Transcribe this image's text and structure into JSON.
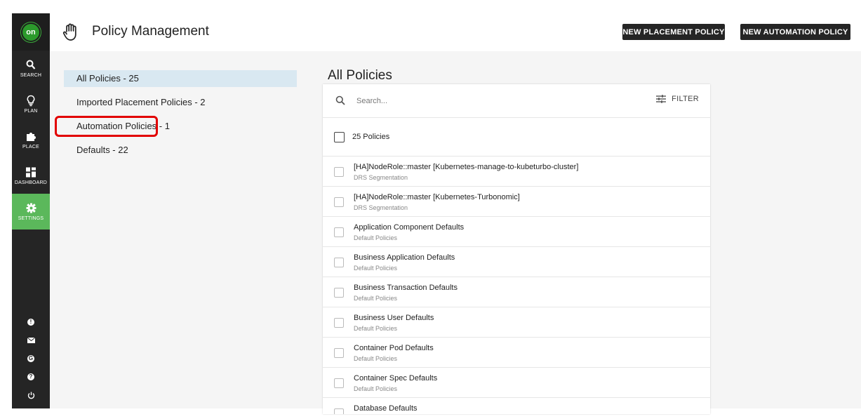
{
  "app": {
    "logo_text": "on",
    "accent_color": "#5bb85b",
    "nav_items": [
      {
        "label": "SEARCH",
        "icon": "search-icon"
      },
      {
        "label": "PLAN",
        "icon": "lightbulb-icon"
      },
      {
        "label": "PLACE",
        "icon": "puzzle-icon"
      },
      {
        "label": "DASHBOARD",
        "icon": "grid-icon"
      },
      {
        "label": "SETTINGS",
        "icon": "gear-icon",
        "active": true
      }
    ],
    "bottom_icons": [
      "info-icon",
      "mail-icon",
      "globe-icon",
      "help-icon",
      "power-icon"
    ]
  },
  "header": {
    "title": "Policy Management",
    "icon": "hand-icon",
    "new_placement_label": "NEW PLACEMENT POLICY",
    "new_automation_label": "NEW AUTOMATION POLICY"
  },
  "filters": [
    {
      "label": "All Policies - 25",
      "selected": true
    },
    {
      "label": "Imported Placement Policies - 2"
    },
    {
      "label": "Automation Policies - 1",
      "highlighted": true
    },
    {
      "label": "Defaults - 22"
    }
  ],
  "list": {
    "title": "All Policies",
    "search_placeholder": "Search...",
    "filter_label": "FILTER",
    "count_label": "25 Policies",
    "rows": [
      {
        "name": "[HA]NodeRole::master [Kubernetes-manage-to-kubeturbo-cluster]",
        "type": "DRS Segmentation"
      },
      {
        "name": "[HA]NodeRole::master [Kubernetes-Turbonomic]",
        "type": "DRS Segmentation"
      },
      {
        "name": "Application Component Defaults",
        "type": "Default Policies"
      },
      {
        "name": "Business Application Defaults",
        "type": "Default Policies"
      },
      {
        "name": "Business Transaction Defaults",
        "type": "Default Policies"
      },
      {
        "name": "Business User Defaults",
        "type": "Default Policies"
      },
      {
        "name": "Container Pod Defaults",
        "type": "Default Policies"
      },
      {
        "name": "Container Spec Defaults",
        "type": "Default Policies"
      },
      {
        "name": "Database Defaults",
        "type": ""
      }
    ]
  }
}
